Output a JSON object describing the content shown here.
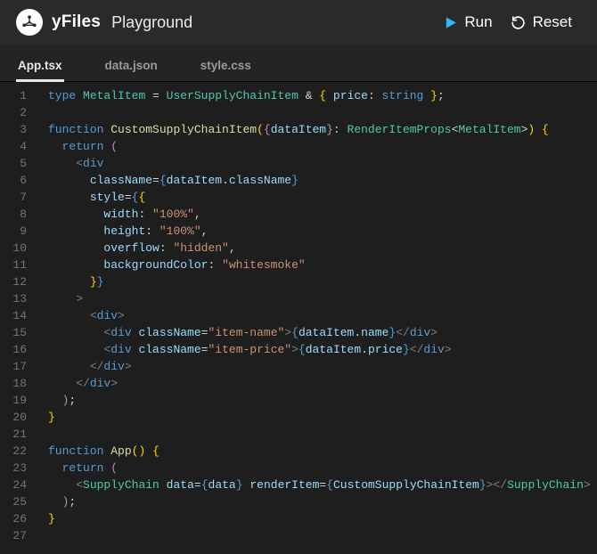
{
  "header": {
    "brand": "yFiles",
    "subtitle": "Playground",
    "logo_name": "yfiles-logo",
    "run_label": "Run",
    "reset_label": "Reset"
  },
  "tabs": [
    {
      "label": "App.tsx",
      "active": true
    },
    {
      "label": "data.json",
      "active": false
    },
    {
      "label": "style.css",
      "active": false
    }
  ],
  "code": {
    "last_line": 27,
    "lines": [
      [
        [
          "kw",
          "type"
        ],
        [
          "punc",
          " "
        ],
        [
          "type",
          "MetalItem"
        ],
        [
          "punc",
          " = "
        ],
        [
          "type",
          "UserSupplyChainItem"
        ],
        [
          "punc",
          " & "
        ],
        [
          "brkt",
          "{"
        ],
        [
          "punc",
          " "
        ],
        [
          "var",
          "price"
        ],
        [
          "punc",
          ": "
        ],
        [
          "kw",
          "string"
        ],
        [
          "punc",
          " "
        ],
        [
          "brkt",
          "}"
        ],
        [
          "punc",
          ";"
        ]
      ],
      [],
      [
        [
          "kw",
          "function"
        ],
        [
          "punc",
          " "
        ],
        [
          "fn",
          "CustomSupplyChainItem"
        ],
        [
          "brkt",
          "("
        ],
        [
          "brkt2",
          "{"
        ],
        [
          "var",
          "dataItem"
        ],
        [
          "brkt2",
          "}"
        ],
        [
          "punc",
          ": "
        ],
        [
          "type",
          "RenderItemProps"
        ],
        [
          "punc",
          "<"
        ],
        [
          "type",
          "MetalItem"
        ],
        [
          "punc",
          ">"
        ],
        [
          "brkt",
          ")"
        ],
        [
          "punc",
          " "
        ],
        [
          "brkt",
          "{"
        ]
      ],
      [
        [
          "punc",
          "  "
        ],
        [
          "kw",
          "return"
        ],
        [
          "punc",
          " "
        ],
        [
          "brkt2",
          "("
        ]
      ],
      [
        [
          "punc",
          "    "
        ],
        [
          "tag",
          "<"
        ],
        [
          "tagn",
          "div"
        ]
      ],
      [
        [
          "punc",
          "      "
        ],
        [
          "attr",
          "className"
        ],
        [
          "punc",
          "="
        ],
        [
          "brkt3",
          "{"
        ],
        [
          "var",
          "dataItem"
        ],
        [
          "punc",
          "."
        ],
        [
          "var",
          "className"
        ],
        [
          "brkt3",
          "}"
        ]
      ],
      [
        [
          "punc",
          "      "
        ],
        [
          "attr",
          "style"
        ],
        [
          "punc",
          "="
        ],
        [
          "brkt3",
          "{"
        ],
        [
          "brkt",
          "{"
        ]
      ],
      [
        [
          "punc",
          "        "
        ],
        [
          "var",
          "width"
        ],
        [
          "punc",
          ": "
        ],
        [
          "str",
          "\"100%\""
        ],
        [
          "punc",
          ","
        ]
      ],
      [
        [
          "punc",
          "        "
        ],
        [
          "var",
          "height"
        ],
        [
          "punc",
          ": "
        ],
        [
          "str",
          "\"100%\""
        ],
        [
          "punc",
          ","
        ]
      ],
      [
        [
          "punc",
          "        "
        ],
        [
          "var",
          "overflow"
        ],
        [
          "punc",
          ": "
        ],
        [
          "str",
          "\"hidden\""
        ],
        [
          "punc",
          ","
        ]
      ],
      [
        [
          "punc",
          "        "
        ],
        [
          "var",
          "backgroundColor"
        ],
        [
          "punc",
          ": "
        ],
        [
          "str",
          "\"whitesmoke\""
        ]
      ],
      [
        [
          "punc",
          "      "
        ],
        [
          "brkt",
          "}"
        ],
        [
          "brkt3",
          "}"
        ]
      ],
      [
        [
          "punc",
          "    "
        ],
        [
          "tag",
          ">"
        ]
      ],
      [
        [
          "punc",
          "      "
        ],
        [
          "tag",
          "<"
        ],
        [
          "tagn",
          "div"
        ],
        [
          "tag",
          ">"
        ]
      ],
      [
        [
          "punc",
          "        "
        ],
        [
          "tag",
          "<"
        ],
        [
          "tagn",
          "div"
        ],
        [
          "punc",
          " "
        ],
        [
          "attr",
          "className"
        ],
        [
          "punc",
          "="
        ],
        [
          "str",
          "\"item-name\""
        ],
        [
          "tag",
          ">"
        ],
        [
          "brkt3",
          "{"
        ],
        [
          "var",
          "dataItem"
        ],
        [
          "punc",
          "."
        ],
        [
          "var",
          "name"
        ],
        [
          "brkt3",
          "}"
        ],
        [
          "tag",
          "</"
        ],
        [
          "tagn",
          "div"
        ],
        [
          "tag",
          ">"
        ]
      ],
      [
        [
          "punc",
          "        "
        ],
        [
          "tag",
          "<"
        ],
        [
          "tagn",
          "div"
        ],
        [
          "punc",
          " "
        ],
        [
          "attr",
          "className"
        ],
        [
          "punc",
          "="
        ],
        [
          "str",
          "\"item-price\""
        ],
        [
          "tag",
          ">"
        ],
        [
          "brkt3",
          "{"
        ],
        [
          "var",
          "dataItem"
        ],
        [
          "punc",
          "."
        ],
        [
          "var",
          "price"
        ],
        [
          "brkt3",
          "}"
        ],
        [
          "tag",
          "</"
        ],
        [
          "tagn",
          "div"
        ],
        [
          "tag",
          ">"
        ]
      ],
      [
        [
          "punc",
          "      "
        ],
        [
          "tag",
          "</"
        ],
        [
          "tagn",
          "div"
        ],
        [
          "tag",
          ">"
        ]
      ],
      [
        [
          "punc",
          "    "
        ],
        [
          "tag",
          "</"
        ],
        [
          "tagn",
          "div"
        ],
        [
          "tag",
          ">"
        ]
      ],
      [
        [
          "punc",
          "  "
        ],
        [
          "brkt2",
          ")"
        ],
        [
          "punc",
          ";"
        ]
      ],
      [
        [
          "brkt",
          "}"
        ]
      ],
      [],
      [
        [
          "kw",
          "function"
        ],
        [
          "punc",
          " "
        ],
        [
          "fn",
          "App"
        ],
        [
          "brkt",
          "("
        ],
        [
          "brkt",
          ")"
        ],
        [
          "punc",
          " "
        ],
        [
          "brkt",
          "{"
        ]
      ],
      [
        [
          "punc",
          "  "
        ],
        [
          "kw",
          "return"
        ],
        [
          "punc",
          " "
        ],
        [
          "brkt2",
          "("
        ]
      ],
      [
        [
          "punc",
          "    "
        ],
        [
          "tag",
          "<"
        ],
        [
          "type",
          "SupplyChain"
        ],
        [
          "punc",
          " "
        ],
        [
          "attr",
          "data"
        ],
        [
          "punc",
          "="
        ],
        [
          "brkt3",
          "{"
        ],
        [
          "var",
          "data"
        ],
        [
          "brkt3",
          "}"
        ],
        [
          "punc",
          " "
        ],
        [
          "attr",
          "renderItem"
        ],
        [
          "punc",
          "="
        ],
        [
          "brkt3",
          "{"
        ],
        [
          "var",
          "CustomSupplyChainItem"
        ],
        [
          "brkt3",
          "}"
        ],
        [
          "tag",
          ">"
        ],
        [
          "tag",
          "</"
        ],
        [
          "type",
          "SupplyChain"
        ],
        [
          "tag",
          ">"
        ]
      ],
      [
        [
          "punc",
          "  "
        ],
        [
          "brkt2",
          ")"
        ],
        [
          "punc",
          ";"
        ]
      ],
      [
        [
          "brkt",
          "}"
        ]
      ],
      []
    ]
  }
}
